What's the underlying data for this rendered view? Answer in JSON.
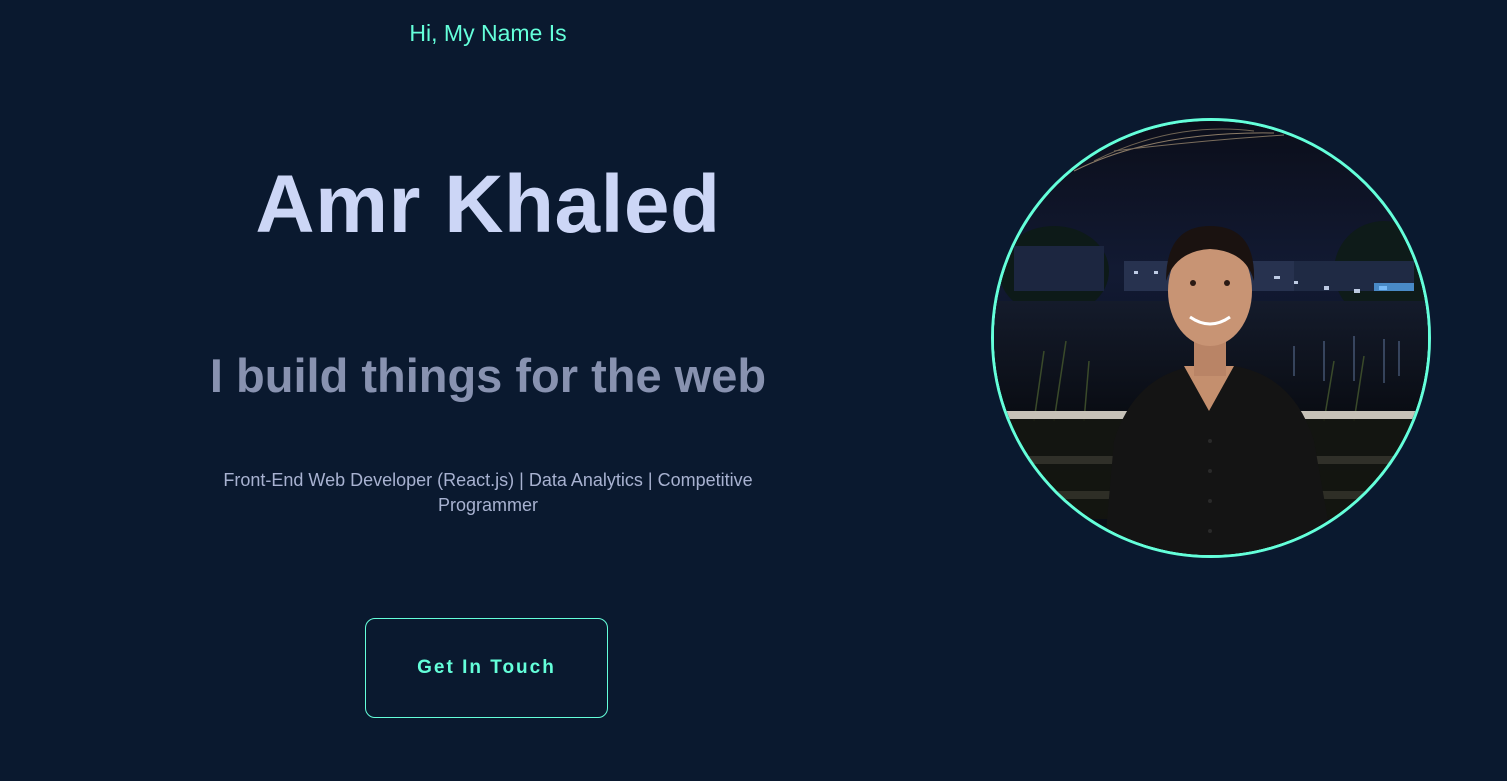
{
  "hero": {
    "greeting": "Hi, My Name Is",
    "name": "Amr Khaled",
    "tagline": "I build things for the web",
    "roles": "Front-End Web Developer (React.js) | Data Analytics | Competitive Programmer",
    "cta_label": "Get In Touch"
  },
  "profile_photo": {
    "alt": "Amr Khaled"
  },
  "colors": {
    "background": "#0a192f",
    "accent": "#64ffda",
    "heading": "#ccd6f6",
    "muted": "#8892b0"
  }
}
